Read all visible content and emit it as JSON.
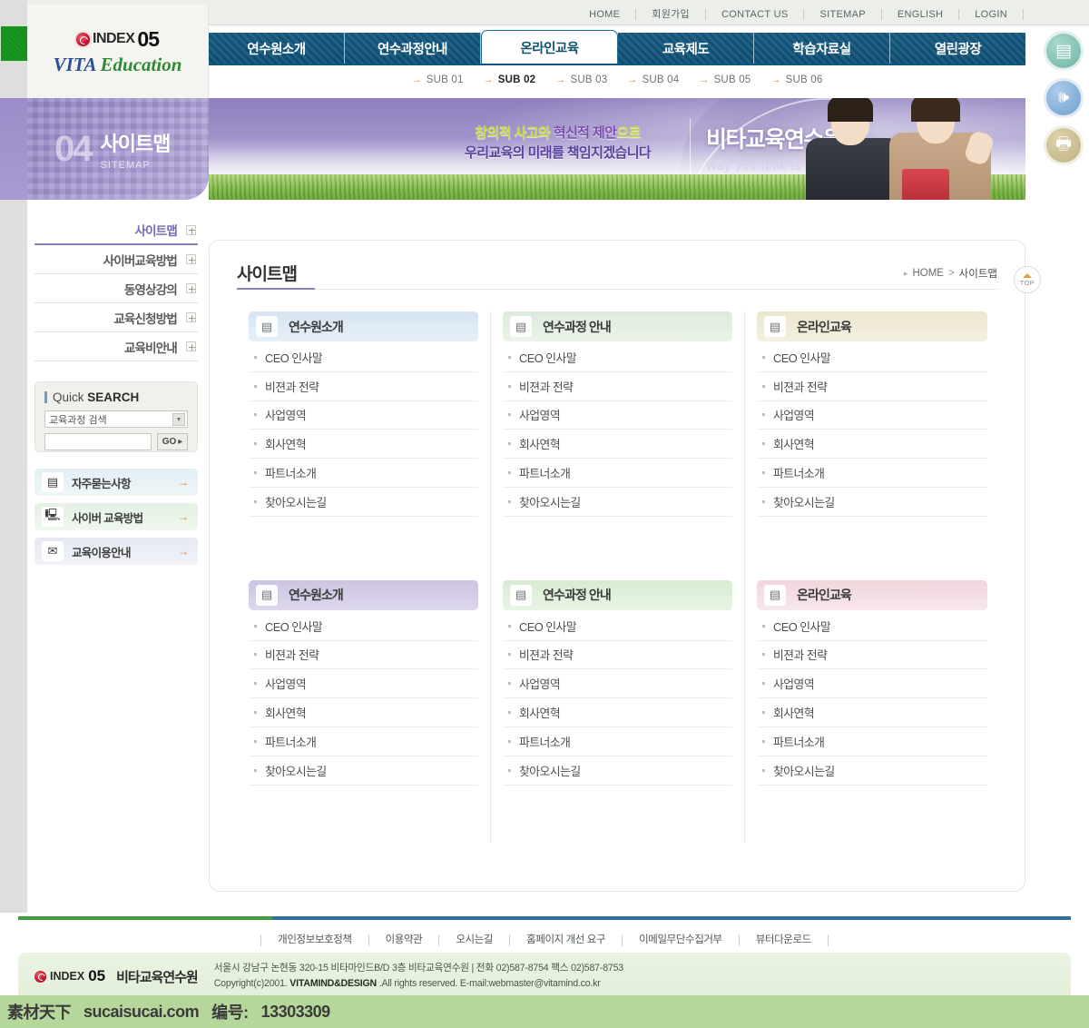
{
  "brand": {
    "index_text": "INDEX",
    "index_num": "05",
    "vita": "VITA",
    "education": "Education"
  },
  "topnav": [
    {
      "label": "HOME"
    },
    {
      "label": "회원가입"
    },
    {
      "label": "CONTACT US"
    },
    {
      "label": "SITEMAP"
    },
    {
      "label": "ENGLISH"
    },
    {
      "label": "LOGIN"
    }
  ],
  "mainnav": [
    {
      "label": "연수원소개",
      "active": false
    },
    {
      "label": "연수과정안내",
      "active": false
    },
    {
      "label": "온라인교육",
      "active": true
    },
    {
      "label": "교육제도",
      "active": false
    },
    {
      "label": "학습자료실",
      "active": false
    },
    {
      "label": "열린광장",
      "active": false
    }
  ],
  "subnav": [
    {
      "label": "SUB 01",
      "active": false
    },
    {
      "label": "SUB 02",
      "active": true
    },
    {
      "label": "SUB 03",
      "active": false
    },
    {
      "label": "SUB 04",
      "active": false
    },
    {
      "label": "SUB 05",
      "active": false
    },
    {
      "label": "SUB 06",
      "active": false
    }
  ],
  "page_title_panel": {
    "number": "04",
    "title_ko": "사이트맵",
    "title_en": "SITEMAP"
  },
  "banner": {
    "slogan_line1_a": "창의적 사고와 ",
    "slogan_line1_b": "혁신적 제안",
    "slogan_line1_c": "으로",
    "slogan_line2": "우리교육의 미래를 책임지겠습니다",
    "brand_ko": "비타교육연수원",
    "brand_en": "Way you look is up to you"
  },
  "sidebar": {
    "lnb": [
      {
        "label": "사이트맵",
        "active": true
      },
      {
        "label": "사이버교육방법",
        "active": false
      },
      {
        "label": "동영상강의",
        "active": false
      },
      {
        "label": "교육신청방법",
        "active": false
      },
      {
        "label": "교육비안내",
        "active": false
      }
    ],
    "quick_search": {
      "title_light": "Quick ",
      "title_bold": "SEARCH",
      "select_value": "교육과정 검색",
      "input_value": "",
      "input_placeholder": "",
      "go_label": "GO"
    },
    "buttons": [
      {
        "label": "자주묻는사항",
        "icon": "document-icon",
        "glyph": "▤"
      },
      {
        "label": "사이버 교육방법",
        "icon": "monitor-icon",
        "glyph": "🖳"
      },
      {
        "label": "교육이용안내",
        "icon": "envelope-icon",
        "glyph": "✉"
      }
    ]
  },
  "content": {
    "title": "사이트맵",
    "breadcrumb": {
      "home": "HOME",
      "separator": ">",
      "current": "사이트맵"
    },
    "top_button": "TOP",
    "link_items": [
      "CEO 인사말",
      "비젼과 전략",
      "사업영역",
      "회사연혁",
      "파트너소개",
      "찾아오시는길"
    ],
    "cards": [
      {
        "title": "연수원소개",
        "theme": "h-blue",
        "col": 0,
        "row": 0
      },
      {
        "title": "연수과정 안내",
        "theme": "h-green",
        "col": 1,
        "row": 0
      },
      {
        "title": "온라인교육",
        "theme": "h-cream",
        "col": 2,
        "row": 0
      },
      {
        "title": "연수원소개",
        "theme": "h-purple",
        "col": 0,
        "row": 1
      },
      {
        "title": "연수과정 안내",
        "theme": "h-mint",
        "col": 1,
        "row": 1
      },
      {
        "title": "온라인교육",
        "theme": "h-pink",
        "col": 2,
        "row": 1
      }
    ]
  },
  "floaters": [
    {
      "name": "document-icon",
      "glyph": "▤"
    },
    {
      "name": "speaker-icon",
      "glyph": "🕪"
    },
    {
      "name": "printer-icon",
      "glyph": "🖶"
    }
  ],
  "footer": {
    "links": [
      {
        "label": "개인정보보호정책"
      },
      {
        "label": "이용약관"
      },
      {
        "label": "오시는길"
      },
      {
        "label": "홈페이지 개선 요구"
      },
      {
        "label": "이메일무단수집거부"
      },
      {
        "label": "뷰터다운로드"
      }
    ],
    "logo_index": "INDEX",
    "logo_num": "05",
    "logo_name": "비타교육연수원",
    "address": "서울시 강남구 논현동 320-15 비타마인드B/D 3층 비타교육연수원  |  전화 02)587-8754 팩스 02)587-8753",
    "copyright_pre": "Copyright(c)2001. ",
    "copyright_bold": "VITAMIND&DESIGN",
    "copyright_post": " .All rights reserved. E-mail:webmaster@vitamind.co.kr"
  },
  "watermark": {
    "site_cn": "素材天下",
    "site_url": "sucaisucai.com",
    "id_label": "编号:",
    "id_value": "13303309"
  }
}
